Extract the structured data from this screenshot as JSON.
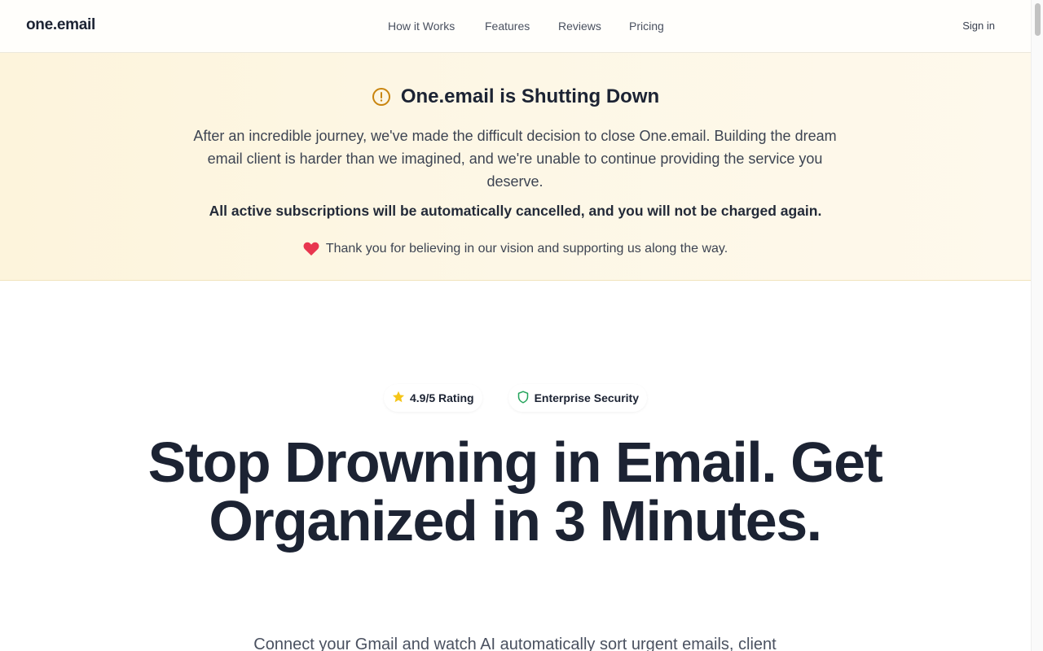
{
  "header": {
    "logo": "one.email",
    "nav": [
      {
        "label": "How it Works"
      },
      {
        "label": "Features"
      },
      {
        "label": "Reviews"
      },
      {
        "label": "Pricing"
      }
    ],
    "signin_label": "Sign in"
  },
  "banner": {
    "icon": "alert-circle-icon",
    "title": "One.email is Shutting Down",
    "body": "After an incredible journey, we've made the difficult decision to close One.email. Building the dream email client is harder than we imagined, and we're unable to continue providing the service you deserve.",
    "notice": "All active subscriptions will be automatically cancelled, and you will not be charged again.",
    "thanks_icon": "heart-icon",
    "thanks": "Thank you for believing in our vision and supporting us along the way.",
    "colors": {
      "background": "#fdf5e0",
      "icon": "#c9850f",
      "heart": "#e8364f"
    }
  },
  "hero": {
    "badges": [
      {
        "icon": "star-icon",
        "label": "4.9/5 Rating"
      },
      {
        "icon": "shield-icon",
        "label": "Enterprise Security"
      }
    ],
    "title": "Stop Drowning in Email. Get Organized in 3 Minutes.",
    "subtitle": "Connect your Gmail and watch AI automatically sort urgent emails, client"
  }
}
